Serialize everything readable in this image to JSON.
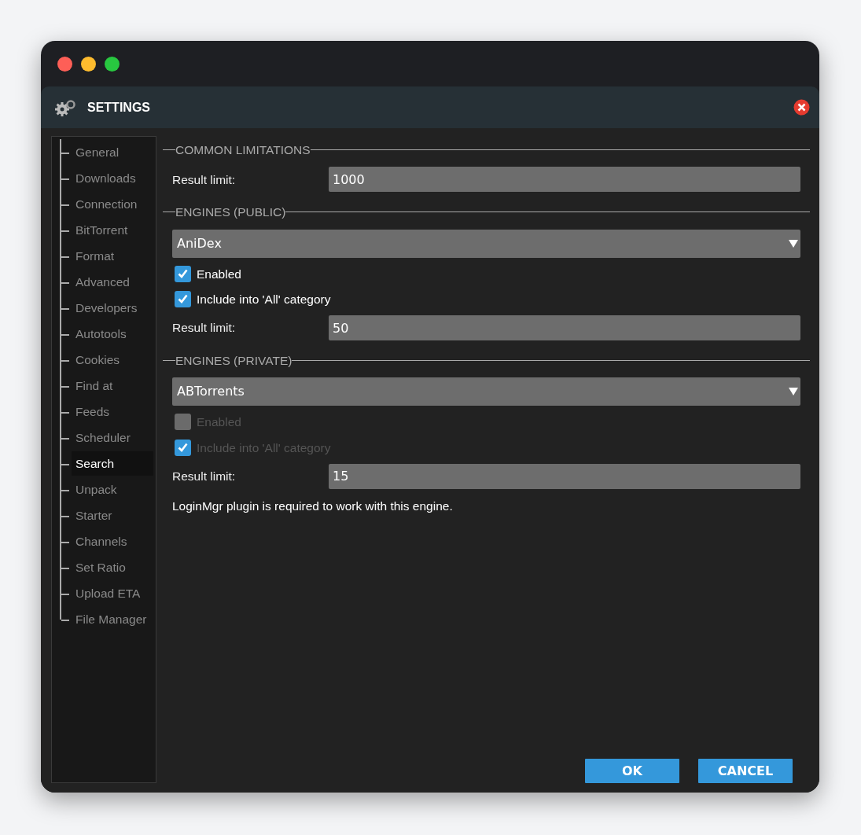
{
  "dialog": {
    "title": "SETTINGS"
  },
  "sidebar": {
    "items": [
      {
        "label": "General",
        "selected": false
      },
      {
        "label": "Downloads",
        "selected": false
      },
      {
        "label": "Connection",
        "selected": false
      },
      {
        "label": "BitTorrent",
        "selected": false
      },
      {
        "label": "Format",
        "selected": false
      },
      {
        "label": "Advanced",
        "selected": false
      },
      {
        "label": "Developers",
        "selected": false
      },
      {
        "label": "Autotools",
        "selected": false
      },
      {
        "label": "Cookies",
        "selected": false
      },
      {
        "label": "Find at",
        "selected": false
      },
      {
        "label": "Feeds",
        "selected": false
      },
      {
        "label": "Scheduler",
        "selected": false
      },
      {
        "label": "Search",
        "selected": true
      },
      {
        "label": "Unpack",
        "selected": false
      },
      {
        "label": "Starter",
        "selected": false
      },
      {
        "label": "Channels",
        "selected": false
      },
      {
        "label": "Set Ratio",
        "selected": false
      },
      {
        "label": "Upload ETA",
        "selected": false
      },
      {
        "label": "File Manager",
        "selected": false
      }
    ]
  },
  "sections": [
    {
      "title": "COMMON LIMITATIONS",
      "rows": [
        {
          "kind": "field",
          "label": "Result limit:",
          "value": "1000"
        }
      ]
    },
    {
      "title": "ENGINES (PUBLIC)",
      "rows": [
        {
          "kind": "select",
          "value": "AniDex"
        },
        {
          "kind": "checkbox",
          "label": "Enabled",
          "checked": true,
          "disabled": false
        },
        {
          "kind": "checkbox",
          "label": "Include into 'All' category",
          "checked": true,
          "disabled": false
        },
        {
          "kind": "field",
          "label": "Result limit:",
          "value": "50"
        }
      ]
    },
    {
      "title": "ENGINES (PRIVATE)",
      "rows": [
        {
          "kind": "select",
          "value": "ABTorrents"
        },
        {
          "kind": "checkbox",
          "label": "Enabled",
          "checked": false,
          "disabled": true
        },
        {
          "kind": "checkbox",
          "label": "Include into 'All' category",
          "checked": true,
          "disabled": true
        },
        {
          "kind": "field",
          "label": "Result limit:",
          "value": "15"
        },
        {
          "kind": "note",
          "text": "LoginMgr plugin is required to work with this engine."
        }
      ]
    }
  ],
  "buttons": [
    "OK",
    "CANCEL"
  ]
}
